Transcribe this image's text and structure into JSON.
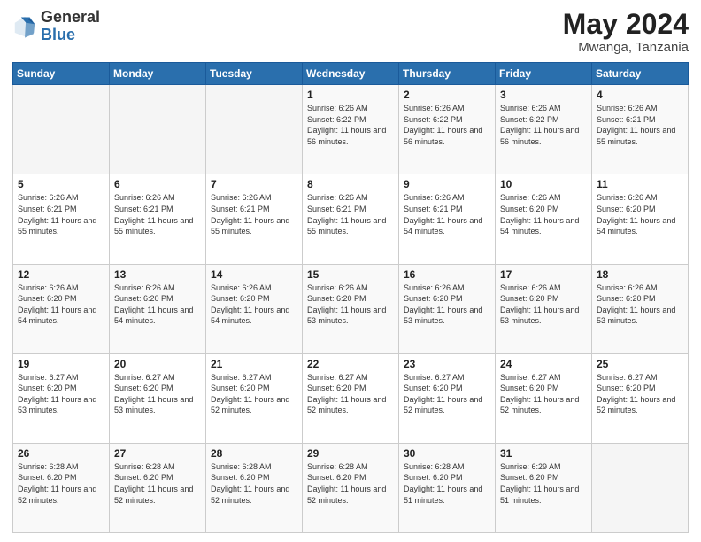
{
  "header": {
    "logo": {
      "general": "General",
      "blue": "Blue"
    },
    "title": "May 2024",
    "location": "Mwanga, Tanzania"
  },
  "weekdays": [
    "Sunday",
    "Monday",
    "Tuesday",
    "Wednesday",
    "Thursday",
    "Friday",
    "Saturday"
  ],
  "weeks": [
    [
      {
        "day": "",
        "info": ""
      },
      {
        "day": "",
        "info": ""
      },
      {
        "day": "",
        "info": ""
      },
      {
        "day": "1",
        "info": "Sunrise: 6:26 AM\nSunset: 6:22 PM\nDaylight: 11 hours and 56 minutes."
      },
      {
        "day": "2",
        "info": "Sunrise: 6:26 AM\nSunset: 6:22 PM\nDaylight: 11 hours and 56 minutes."
      },
      {
        "day": "3",
        "info": "Sunrise: 6:26 AM\nSunset: 6:22 PM\nDaylight: 11 hours and 56 minutes."
      },
      {
        "day": "4",
        "info": "Sunrise: 6:26 AM\nSunset: 6:21 PM\nDaylight: 11 hours and 55 minutes."
      }
    ],
    [
      {
        "day": "5",
        "info": "Sunrise: 6:26 AM\nSunset: 6:21 PM\nDaylight: 11 hours and 55 minutes."
      },
      {
        "day": "6",
        "info": "Sunrise: 6:26 AM\nSunset: 6:21 PM\nDaylight: 11 hours and 55 minutes."
      },
      {
        "day": "7",
        "info": "Sunrise: 6:26 AM\nSunset: 6:21 PM\nDaylight: 11 hours and 55 minutes."
      },
      {
        "day": "8",
        "info": "Sunrise: 6:26 AM\nSunset: 6:21 PM\nDaylight: 11 hours and 55 minutes."
      },
      {
        "day": "9",
        "info": "Sunrise: 6:26 AM\nSunset: 6:21 PM\nDaylight: 11 hours and 54 minutes."
      },
      {
        "day": "10",
        "info": "Sunrise: 6:26 AM\nSunset: 6:20 PM\nDaylight: 11 hours and 54 minutes."
      },
      {
        "day": "11",
        "info": "Sunrise: 6:26 AM\nSunset: 6:20 PM\nDaylight: 11 hours and 54 minutes."
      }
    ],
    [
      {
        "day": "12",
        "info": "Sunrise: 6:26 AM\nSunset: 6:20 PM\nDaylight: 11 hours and 54 minutes."
      },
      {
        "day": "13",
        "info": "Sunrise: 6:26 AM\nSunset: 6:20 PM\nDaylight: 11 hours and 54 minutes."
      },
      {
        "day": "14",
        "info": "Sunrise: 6:26 AM\nSunset: 6:20 PM\nDaylight: 11 hours and 54 minutes."
      },
      {
        "day": "15",
        "info": "Sunrise: 6:26 AM\nSunset: 6:20 PM\nDaylight: 11 hours and 53 minutes."
      },
      {
        "day": "16",
        "info": "Sunrise: 6:26 AM\nSunset: 6:20 PM\nDaylight: 11 hours and 53 minutes."
      },
      {
        "day": "17",
        "info": "Sunrise: 6:26 AM\nSunset: 6:20 PM\nDaylight: 11 hours and 53 minutes."
      },
      {
        "day": "18",
        "info": "Sunrise: 6:26 AM\nSunset: 6:20 PM\nDaylight: 11 hours and 53 minutes."
      }
    ],
    [
      {
        "day": "19",
        "info": "Sunrise: 6:27 AM\nSunset: 6:20 PM\nDaylight: 11 hours and 53 minutes."
      },
      {
        "day": "20",
        "info": "Sunrise: 6:27 AM\nSunset: 6:20 PM\nDaylight: 11 hours and 53 minutes."
      },
      {
        "day": "21",
        "info": "Sunrise: 6:27 AM\nSunset: 6:20 PM\nDaylight: 11 hours and 52 minutes."
      },
      {
        "day": "22",
        "info": "Sunrise: 6:27 AM\nSunset: 6:20 PM\nDaylight: 11 hours and 52 minutes."
      },
      {
        "day": "23",
        "info": "Sunrise: 6:27 AM\nSunset: 6:20 PM\nDaylight: 11 hours and 52 minutes."
      },
      {
        "day": "24",
        "info": "Sunrise: 6:27 AM\nSunset: 6:20 PM\nDaylight: 11 hours and 52 minutes."
      },
      {
        "day": "25",
        "info": "Sunrise: 6:27 AM\nSunset: 6:20 PM\nDaylight: 11 hours and 52 minutes."
      }
    ],
    [
      {
        "day": "26",
        "info": "Sunrise: 6:28 AM\nSunset: 6:20 PM\nDaylight: 11 hours and 52 minutes."
      },
      {
        "day": "27",
        "info": "Sunrise: 6:28 AM\nSunset: 6:20 PM\nDaylight: 11 hours and 52 minutes."
      },
      {
        "day": "28",
        "info": "Sunrise: 6:28 AM\nSunset: 6:20 PM\nDaylight: 11 hours and 52 minutes."
      },
      {
        "day": "29",
        "info": "Sunrise: 6:28 AM\nSunset: 6:20 PM\nDaylight: 11 hours and 52 minutes."
      },
      {
        "day": "30",
        "info": "Sunrise: 6:28 AM\nSunset: 6:20 PM\nDaylight: 11 hours and 51 minutes."
      },
      {
        "day": "31",
        "info": "Sunrise: 6:29 AM\nSunset: 6:20 PM\nDaylight: 11 hours and 51 minutes."
      },
      {
        "day": "",
        "info": ""
      }
    ]
  ]
}
